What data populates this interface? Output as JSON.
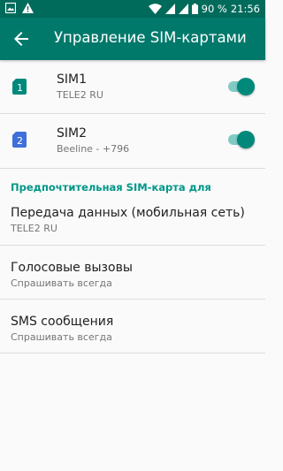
{
  "status_bar": {
    "battery": "90 %",
    "time": "21:56",
    "icons": [
      "image-icon",
      "warning-icon",
      "wifi-icon",
      "signal-icon",
      "signal-icon",
      "battery-icon"
    ]
  },
  "toolbar": {
    "title": "Управление SIM-картами",
    "back_icon": "arrow-back-icon"
  },
  "sims": [
    {
      "badge": "1",
      "name": "SIM1",
      "operator": "TELE2 RU",
      "enabled": true,
      "color": "#00897b"
    },
    {
      "badge": "2",
      "name": "SIM2",
      "operator": "Beeline - +796",
      "enabled": true,
      "color": "#3f6fd8"
    }
  ],
  "preferred": {
    "header": "Предпочтительная SIM-карта для",
    "items": [
      {
        "title": "Передача данных (мобильная сеть)",
        "value": "TELE2 RU"
      },
      {
        "title": "Голосовые вызовы",
        "value": "Спрашивать всегда"
      },
      {
        "title": "SMS сообщения",
        "value": "Спрашивать всегда"
      }
    ]
  },
  "colors": {
    "accent": "#009688",
    "toolbar": "#00796b",
    "statusbar": "#006b5b"
  }
}
